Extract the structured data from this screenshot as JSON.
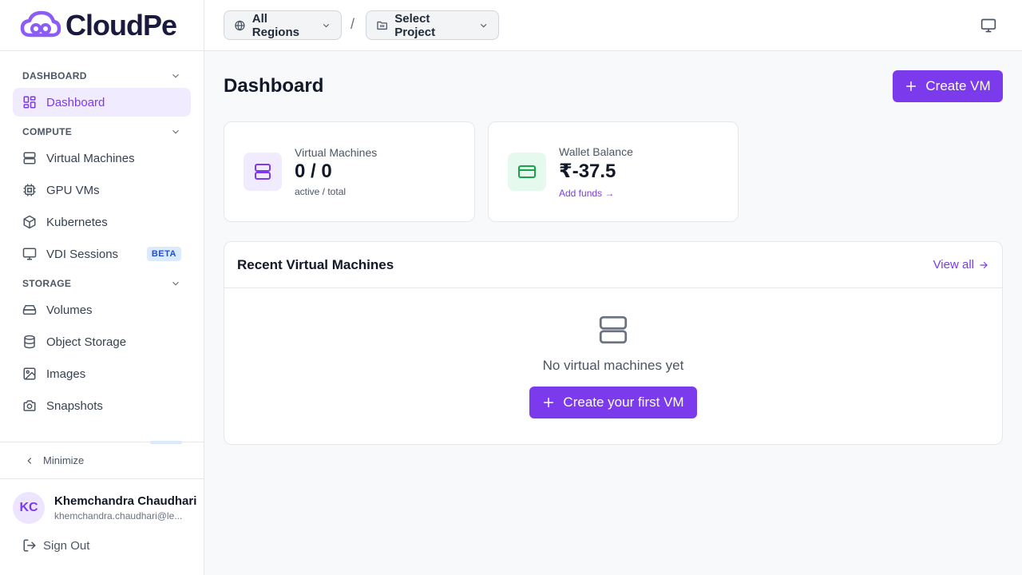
{
  "brand": {
    "name": "CloudPe"
  },
  "sidebar": {
    "sections": [
      {
        "title": "DASHBOARD",
        "items": [
          {
            "label": "Dashboard",
            "icon": "dashboard-icon",
            "active": true
          }
        ]
      },
      {
        "title": "COMPUTE",
        "items": [
          {
            "label": "Virtual Machines",
            "icon": "server-icon"
          },
          {
            "label": "GPU VMs",
            "icon": "cpu-icon"
          },
          {
            "label": "Kubernetes",
            "icon": "cube-icon"
          },
          {
            "label": "VDI Sessions",
            "icon": "monitor-icon",
            "badge": "BETA"
          }
        ]
      },
      {
        "title": "STORAGE",
        "items": [
          {
            "label": "Volumes",
            "icon": "hard-drive-icon"
          },
          {
            "label": "Object Storage",
            "icon": "database-icon"
          },
          {
            "label": "Images",
            "icon": "image-icon"
          },
          {
            "label": "Snapshots",
            "icon": "camera-icon"
          }
        ]
      }
    ],
    "minimize_label": "Minimize",
    "user": {
      "initials": "KC",
      "name": "Khemchandra Chaudhari",
      "email": "khemchandra.chaudhari@le..."
    },
    "signout_label": "Sign Out"
  },
  "topbar": {
    "region_label": "All Regions",
    "separator": "/",
    "project_label": "Select Project"
  },
  "main": {
    "title": "Dashboard",
    "create_vm_label": "Create VM",
    "stats": {
      "vms": {
        "label": "Virtual Machines",
        "value": "0 / 0",
        "sub": "active / total"
      },
      "wallet": {
        "label": "Wallet Balance",
        "value": "₹-37.5",
        "link": "Add funds →"
      }
    },
    "recent": {
      "title": "Recent Virtual Machines",
      "view_all": "View all",
      "empty_text": "No virtual machines yet",
      "create_first_label": "Create your first VM"
    }
  },
  "colors": {
    "accent": "#7c3aed",
    "accent_soft": "#f1ebff",
    "success_soft": "#e6f9ee",
    "success": "#16a34a"
  }
}
